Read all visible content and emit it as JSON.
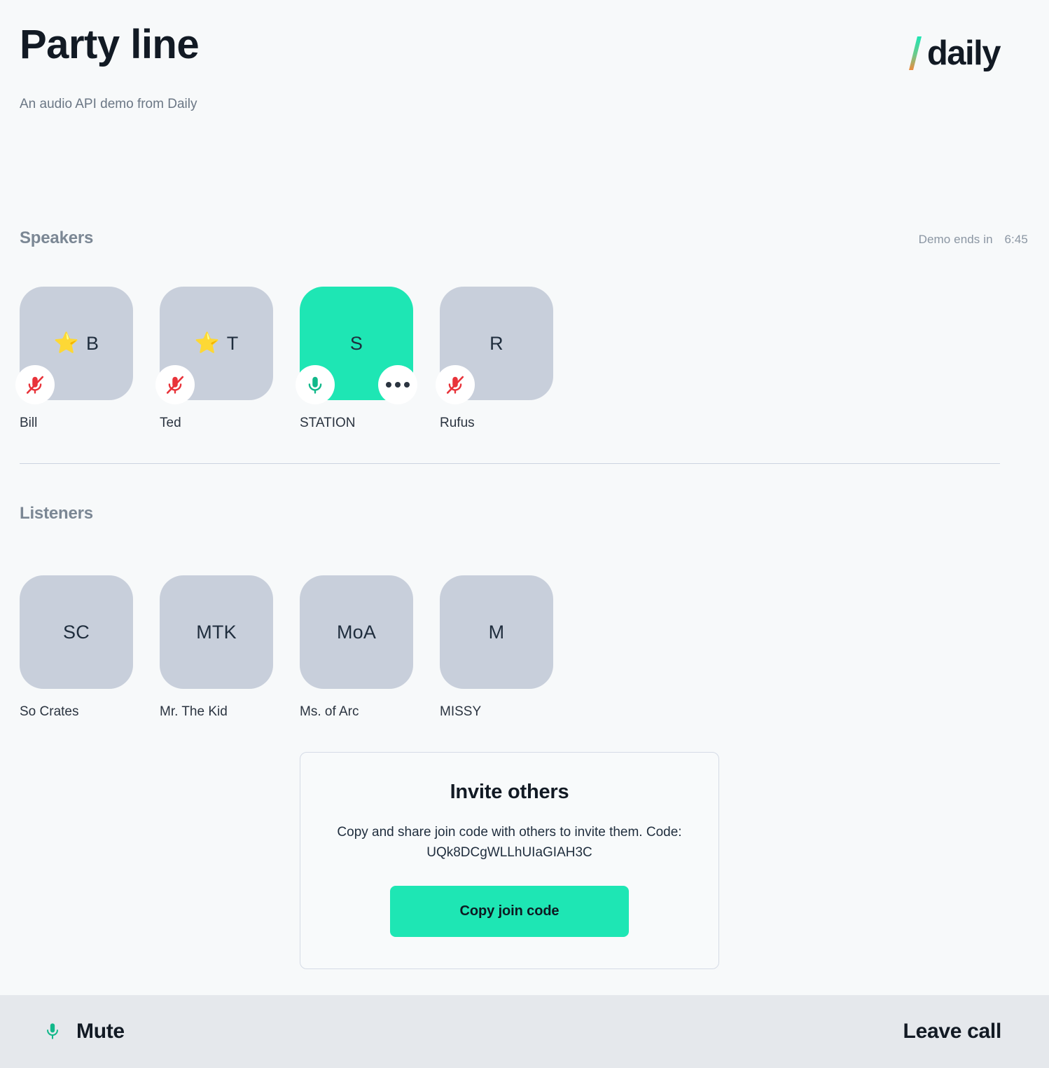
{
  "header": {
    "title": "Party line",
    "subtitle": "An audio API demo from Daily",
    "brand": "daily",
    "brand_slash_gradient_from": "#1ee6b4",
    "brand_slash_gradient_to": "#f08a3c"
  },
  "speakers_section": {
    "title": "Speakers",
    "timer_label": "Demo ends in",
    "timer_value": "6:45",
    "participants": [
      {
        "name": "Bill",
        "initials": "B",
        "is_moderator": true,
        "star": "⭐",
        "muted": true,
        "active": false,
        "has_menu": false
      },
      {
        "name": "Ted",
        "initials": "T",
        "is_moderator": true,
        "star": "⭐",
        "muted": true,
        "active": false,
        "has_menu": false
      },
      {
        "name": "STATION",
        "initials": "S",
        "is_moderator": false,
        "star": "",
        "muted": false,
        "active": true,
        "has_menu": true
      },
      {
        "name": "Rufus",
        "initials": "R",
        "is_moderator": false,
        "star": "",
        "muted": true,
        "active": false,
        "has_menu": false
      }
    ]
  },
  "listeners_section": {
    "title": "Listeners",
    "participants": [
      {
        "name": "So Crates",
        "initials": "SC"
      },
      {
        "name": "Mr. The Kid",
        "initials": "MTK"
      },
      {
        "name": "Ms. of Arc",
        "initials": "MoA"
      },
      {
        "name": "MISSY",
        "initials": "M"
      }
    ]
  },
  "invite": {
    "title": "Invite others",
    "description_prefix": "Copy and share join code with others to invite them. Code: ",
    "code": "UQk8DCgWLLhUIaGIAH3C",
    "button_label": "Copy join code"
  },
  "bottom_bar": {
    "mute_label": "Mute",
    "leave_label": "Leave call"
  },
  "colors": {
    "page_background": "#f7f9fa",
    "tile_default": "#c8cfdb",
    "accent_green": "#1ee6b4",
    "muted_red": "#e8333a",
    "bottom_bar": "#e5e8ec",
    "text_dark": "#121a24",
    "text_muted": "#7b8794"
  }
}
